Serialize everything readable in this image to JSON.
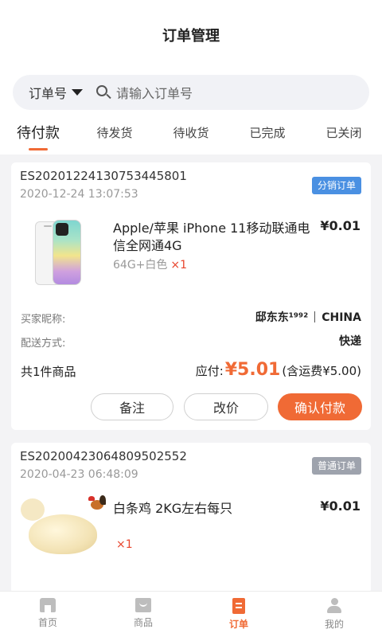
{
  "header": {
    "title": "订单管理"
  },
  "search": {
    "type_label": "订单号",
    "placeholder": "请输入订单号"
  },
  "tabs": [
    {
      "label": "待付款",
      "active": true
    },
    {
      "label": "待发货"
    },
    {
      "label": "待收货"
    },
    {
      "label": "已完成"
    },
    {
      "label": "已关闭"
    }
  ],
  "orders": [
    {
      "order_no": "ES20201224130753445801",
      "time": "2020-12-24 13:07:53",
      "badge": "分销订单",
      "product_title": "Apple/苹果 iPhone 11移动联通电信全网通4G",
      "price": "¥0.01",
      "spec": "64G+白色",
      "qty": "×1",
      "buyer_label": "买家昵称:",
      "buyer_name": "邸东东¹⁹⁹²",
      "buyer_country": "CHINA",
      "delivery_label": "配送方式:",
      "delivery_value": "快递",
      "count_text": "共1件商品",
      "payable_label": "应付:",
      "payable_amount": "¥5.01",
      "shipping_note": "(含运费¥5.00)",
      "buttons": {
        "remark": "备注",
        "change_price": "改价",
        "confirm_pay": "确认付款"
      }
    },
    {
      "order_no": "ES20200423064809502552",
      "time": "2020-04-23 06:48:09",
      "badge": "普通订单",
      "product_title": "白条鸡 2KG左右每只",
      "price": "¥0.01",
      "qty": "×1"
    }
  ],
  "bottom_nav": [
    {
      "label": "首页",
      "icon": "home-icon"
    },
    {
      "label": "商品",
      "icon": "goods-icon"
    },
    {
      "label": "订单",
      "icon": "order-icon",
      "active": true
    },
    {
      "label": "我的",
      "icon": "user-icon"
    }
  ],
  "colors": {
    "accent": "#f06a35",
    "badge_blue": "#4a90e2",
    "badge_grey": "#9ea3ad"
  }
}
